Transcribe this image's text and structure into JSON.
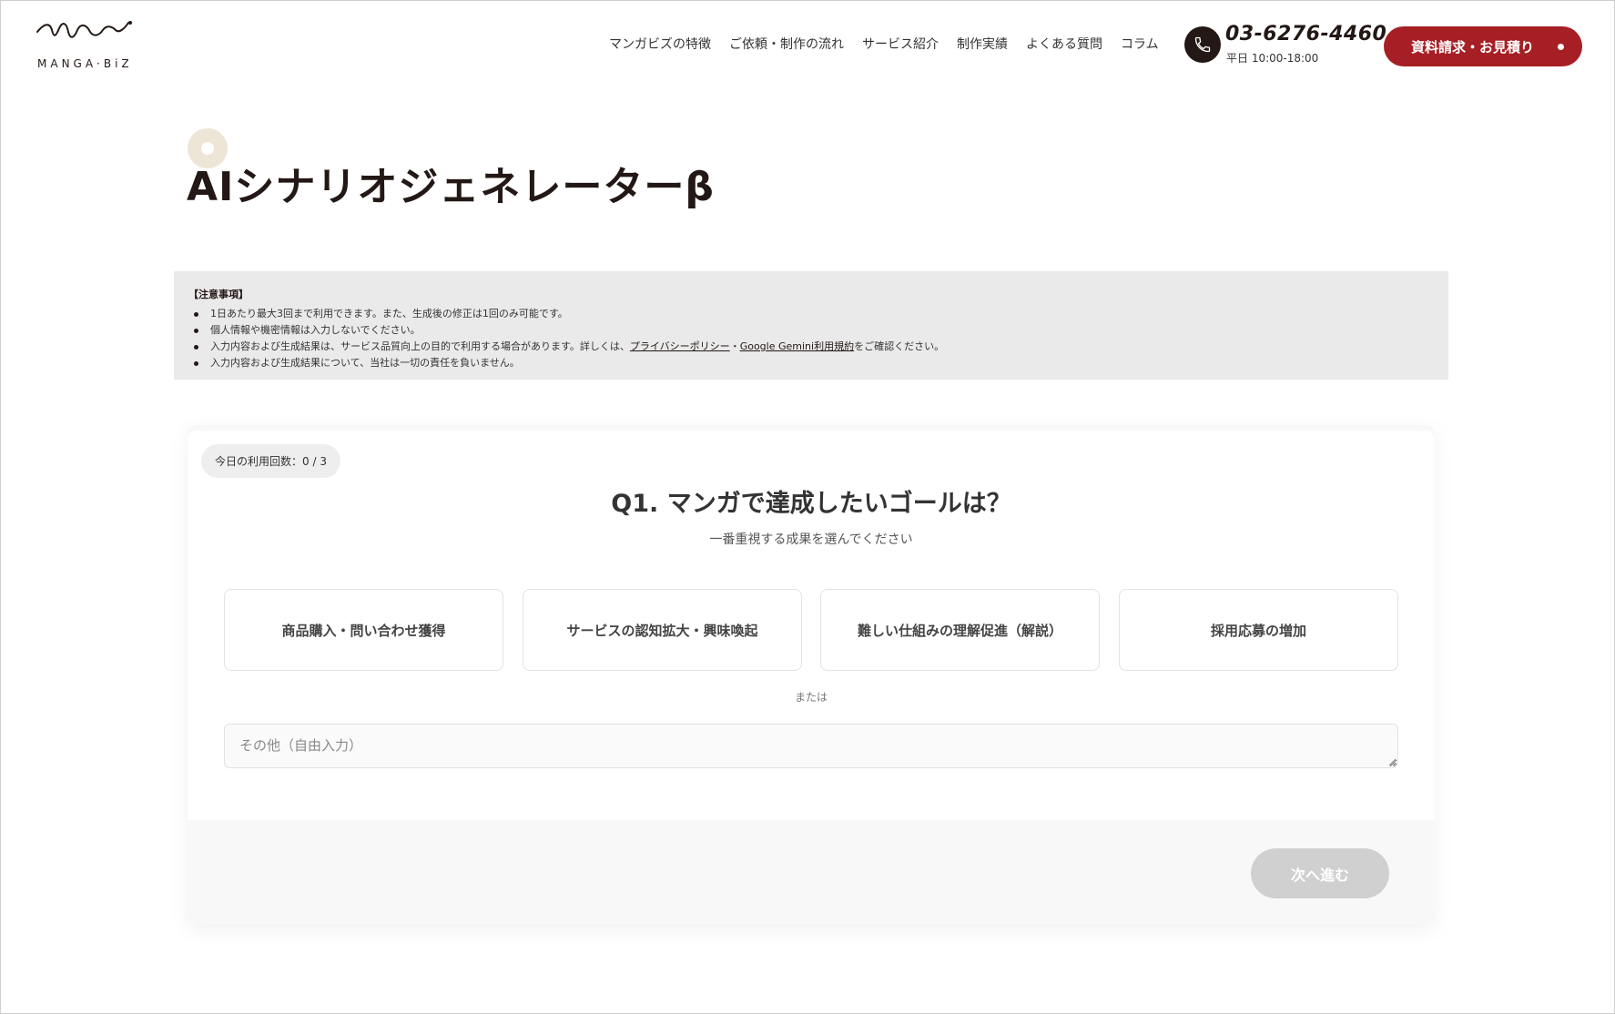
{
  "header": {
    "logo_text": "MANGA·BiZ",
    "nav": [
      "マンガビズの特徴",
      "ご依頼・制作の流れ",
      "サービス紹介",
      "制作実績",
      "よくある質問",
      "コラム"
    ],
    "phone": "03-6276-4460",
    "hours": "平日 10:00-18:00",
    "cta_label": "資料請求・お見積り"
  },
  "page": {
    "title": "AIシナリオジェネレーターβ"
  },
  "notice": {
    "heading": "【注意事項】",
    "items": [
      "1日あたり最大3回まで利用できます。また、生成後の修正は1回のみ可能です。",
      "個人情報や機密情報は入力しないでください。",
      "入力内容および生成結果について、当社は一切の責任を負いません。"
    ],
    "privacy_item": {
      "prefix": "入力内容および生成結果は、サービス品質向上の目的で利用する場合があります。詳しくは、",
      "link1": "プライバシーポリシー",
      "separator": "・",
      "link2": "Google Gemini利用規約",
      "suffix": "をご確認ください。"
    }
  },
  "form": {
    "usage": "今日の利用回数：0 / 3",
    "question": "Q1. マンガで達成したいゴールは？",
    "subtitle": "一番重視する成果を選んでください",
    "options": [
      "商品購入・問い合わせ獲得",
      "サービスの認知拡大・興味喚起",
      "難しい仕組みの理解促進（解説）",
      "採用応募の増加"
    ],
    "or_label": "または",
    "free_placeholder": "その他（自由入力）",
    "next_label": "次へ進む"
  },
  "colors": {
    "brand": "#a51f24",
    "title_deco": "#ede5d6",
    "notice_bg": "#eaeaea",
    "disabled_button": "#d0d0d0"
  }
}
